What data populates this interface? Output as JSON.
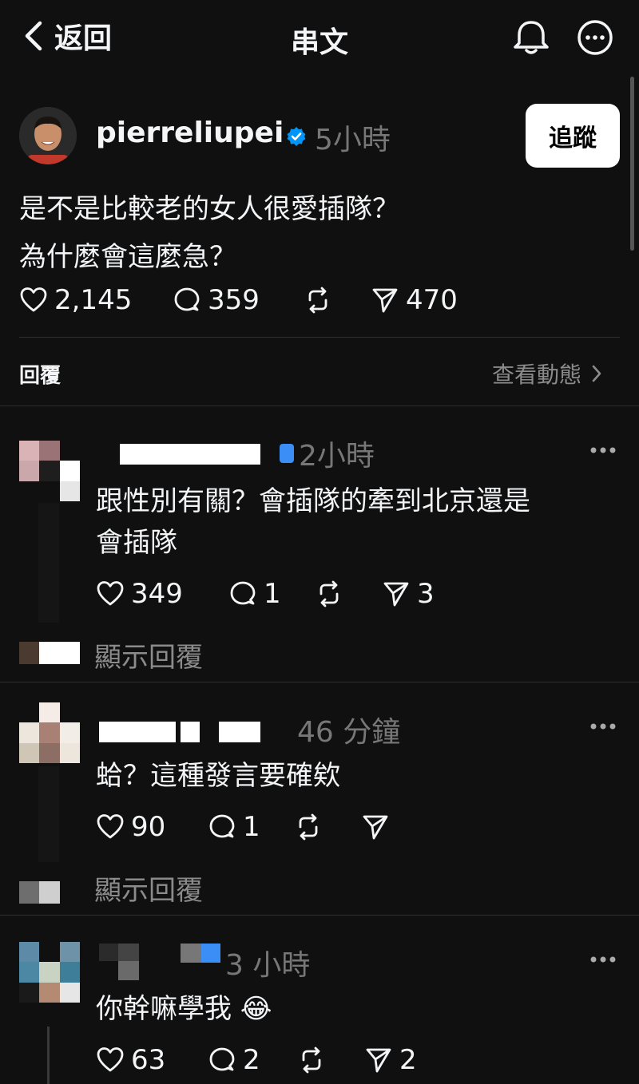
{
  "header": {
    "back_label": "返回",
    "title": "串文"
  },
  "post": {
    "username": "pierreliupei",
    "time": "5小時",
    "follow_label": "追蹤",
    "lines": [
      "是不是比較老的女人很愛插隊？",
      "為什麼會這麼急？"
    ],
    "likes": "2,145",
    "comments": "359",
    "shares": "470"
  },
  "replies_header": {
    "label": "回覆",
    "view_activity": "查看動態"
  },
  "comments": [
    {
      "time": "2小時",
      "lines": [
        "跟性別有關？會插隊的牽到北京還是",
        "會插隊"
      ],
      "likes": "349",
      "comments": "1",
      "shares": "3",
      "show_replies": "顯示回覆"
    },
    {
      "time": "46 分鐘",
      "lines": [
        "蛤？這種發言要確欸"
      ],
      "likes": "90",
      "comments": "1",
      "shares": "",
      "show_replies": "顯示回覆"
    },
    {
      "time": "3 小時",
      "lines": [
        "你幹嘛學我 😂"
      ],
      "likes": "63",
      "comments": "2",
      "shares": "2"
    }
  ],
  "colors": {
    "background": "#101010",
    "text": "#f3f5f7",
    "muted": "#777777",
    "verified": "#0095f6"
  }
}
